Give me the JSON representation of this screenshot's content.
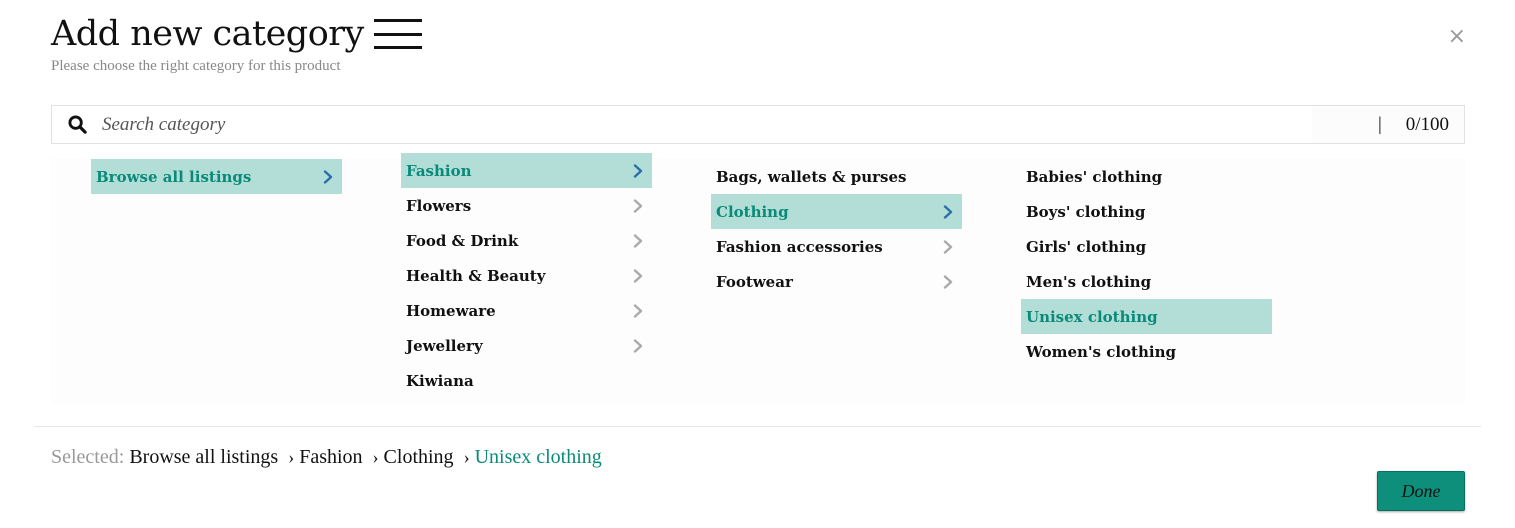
{
  "header": {
    "title": "Add new category",
    "subtitle": "Please choose the right category for this product",
    "close_label": "×"
  },
  "search": {
    "placeholder": "Search category",
    "value": "",
    "counter": "0/100",
    "separator": "|"
  },
  "columns": [
    {
      "items": [
        {
          "label": "Browse all listings",
          "has_children": true,
          "active": true
        }
      ]
    },
    {
      "items": [
        {
          "label": "Fashion",
          "has_children": true,
          "active": true
        },
        {
          "label": "Flowers",
          "has_children": true,
          "active": false
        },
        {
          "label": "Food & Drink",
          "has_children": true,
          "active": false
        },
        {
          "label": "Health & Beauty",
          "has_children": true,
          "active": false
        },
        {
          "label": "Homeware",
          "has_children": true,
          "active": false
        },
        {
          "label": "Jewellery",
          "has_children": true,
          "active": false
        },
        {
          "label": "Kiwiana",
          "has_children": false,
          "active": false
        }
      ]
    },
    {
      "items": [
        {
          "label": "Bags, wallets & purses",
          "has_children": false,
          "active": false
        },
        {
          "label": "Clothing",
          "has_children": true,
          "active": true
        },
        {
          "label": "Fashion accessories",
          "has_children": true,
          "active": false
        },
        {
          "label": "Footwear",
          "has_children": true,
          "active": false
        }
      ]
    },
    {
      "items": [
        {
          "label": "Babies' clothing",
          "has_children": false,
          "active": false
        },
        {
          "label": "Boys' clothing",
          "has_children": false,
          "active": false
        },
        {
          "label": "Girls' clothing",
          "has_children": false,
          "active": false
        },
        {
          "label": "Men's clothing",
          "has_children": false,
          "active": false
        },
        {
          "label": "Unisex clothing",
          "has_children": false,
          "active": true
        },
        {
          "label": "Women's clothing",
          "has_children": false,
          "active": false
        }
      ]
    }
  ],
  "selected": {
    "label": "Selected:",
    "path": [
      "Browse all listings",
      "Fashion",
      "Clothing",
      "Unisex clothing"
    ],
    "separator": "›"
  },
  "footer": {
    "done_label": "Done"
  },
  "colors": {
    "accent": "#0a8a78",
    "active_bg": "#b3ded8",
    "button_bg": "#0d8f7b",
    "chevron_active": "#2a6fa8",
    "chevron_inactive": "#aaaaaa"
  },
  "icons": {
    "search": "search-icon",
    "menu": "hamburger-menu-icon",
    "close": "close-icon",
    "chevron": "chevron-right-icon"
  }
}
